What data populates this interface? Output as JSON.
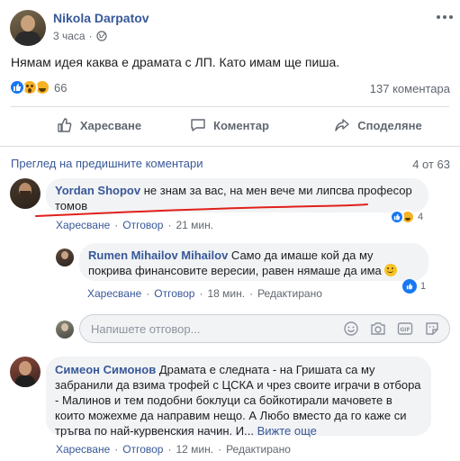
{
  "post": {
    "author": "Nikola Darpatov",
    "time": "3 часа",
    "text": "Нямам идея каква е драмата с ЛП. Като имам ще пиша.",
    "reaction_count": "66",
    "comment_count": "137 коментара",
    "actions": {
      "like": "Харесване",
      "comment": "Коментар",
      "share": "Споделяне"
    }
  },
  "comments_header": {
    "previous": "Преглед на предишните коментари",
    "counter": "4 от 63"
  },
  "comments": [
    {
      "author": "Yordan Shopov",
      "text": "не знам за вас, на мен вече ми липсва професор томов",
      "like": "Харесване",
      "reply": "Отговор",
      "time": "21 мин.",
      "reactions": "4",
      "replies": [
        {
          "author": "Rumen Mihailov Mihailov",
          "text": "Само да имаше кой да му покрива финансовите вересии, равен нямаше да има",
          "like": "Харесване",
          "reply": "Отговор",
          "time": "18 мин.",
          "edited": "Редактирано",
          "reactions": "1"
        }
      ],
      "reply_placeholder": "Напишете отговор..."
    },
    {
      "author": "Симеон Симонов",
      "text": "Драмата е следната - на Гришата са му забранили да взима трофей с ЦСКА и чрез своите играчи в отбора - Малинов и тем подобни боклуци са бойкотирали мачовете в които можехме да направим нещо. А Любо вместо да го каже си тръгва по най-курвенския начин. И...",
      "see_more": "Вижте още",
      "like": "Харесване",
      "reply": "Отговор",
      "time": "12 мин.",
      "edited": "Редактирано"
    }
  ],
  "colors": {
    "link": "#385898",
    "meta": "#606770",
    "bubble": "#f2f3f5",
    "like_blue": "#1877f2",
    "annotation_red": "#e0201b"
  }
}
